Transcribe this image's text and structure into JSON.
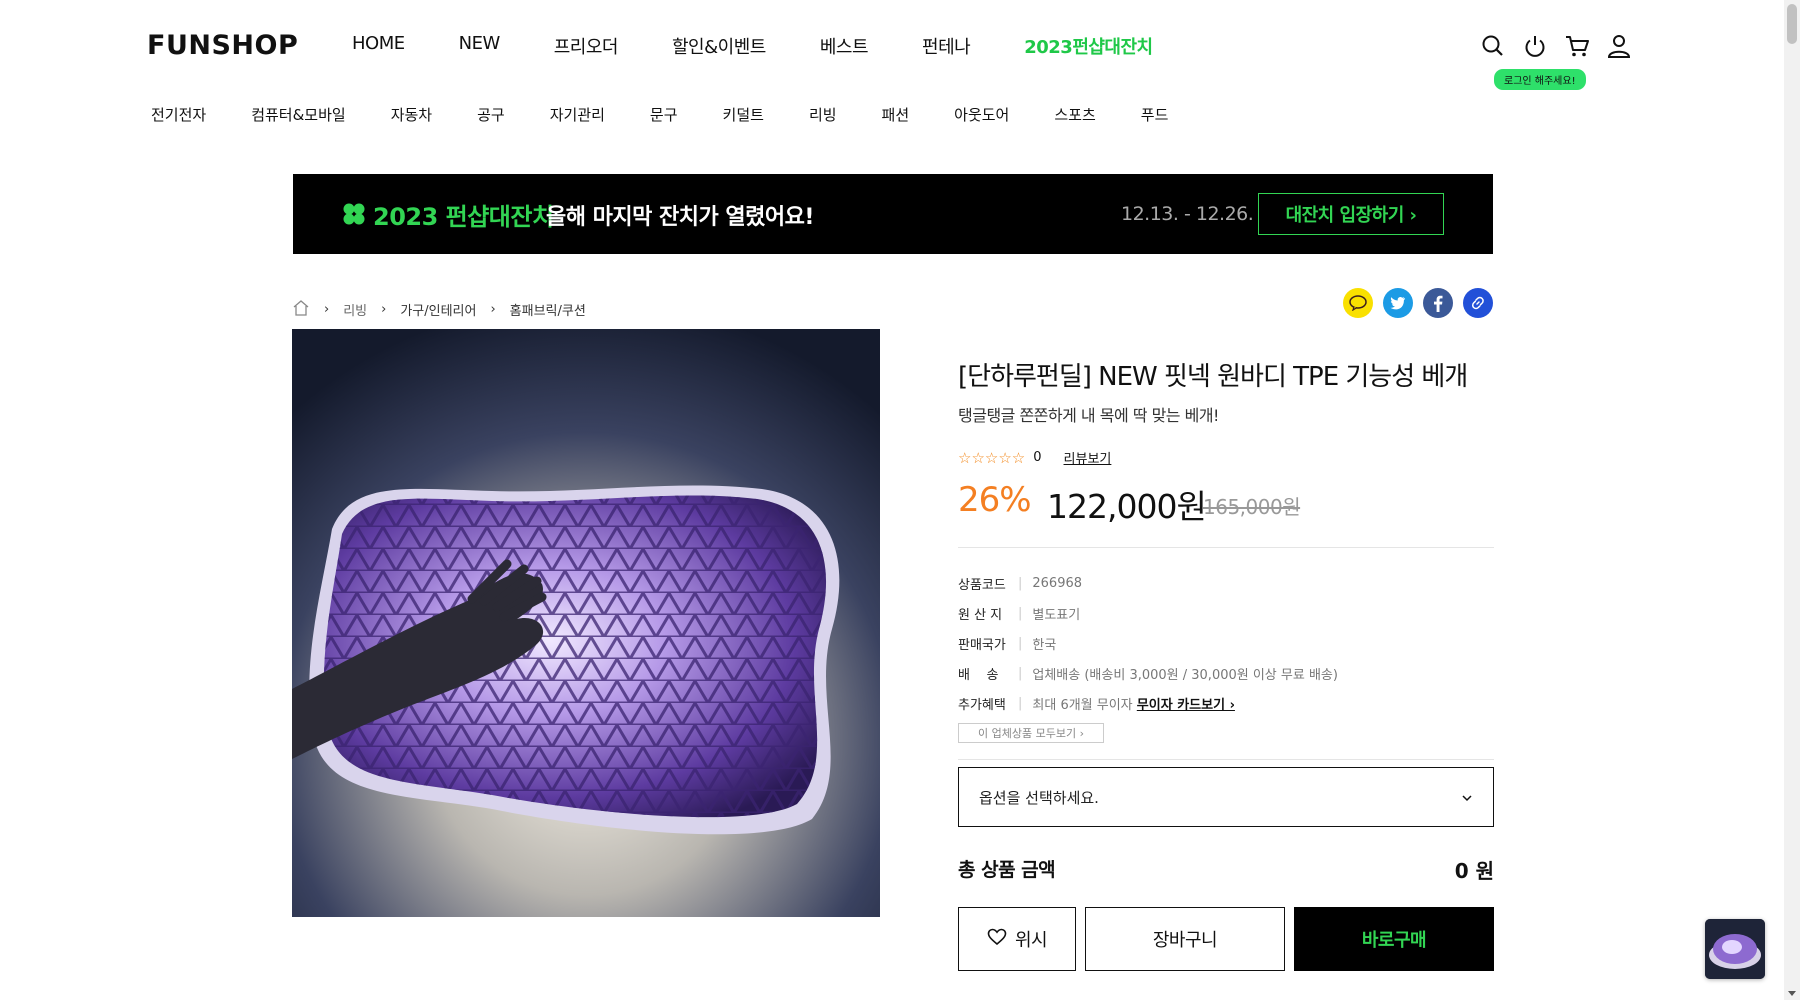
{
  "header": {
    "logo": "FUNSHOP",
    "gnb": [
      "HOME",
      "NEW",
      "프리오더",
      "할인&이벤트",
      "베스트",
      "펀테나",
      "2023펀샵대잔치"
    ],
    "icons": [
      "search-icon",
      "power-icon",
      "cart-icon",
      "user-icon"
    ],
    "login_badge": "로그인 해주세요!"
  },
  "categories": [
    "전기전자",
    "컴퓨터&모바일",
    "자동차",
    "공구",
    "자기관리",
    "문구",
    "키덜트",
    "리빙",
    "패션",
    "아웃도어",
    "스포츠",
    "푸드"
  ],
  "banner": {
    "title_green": "2023 펀샵대잔치",
    "title_white": "올해 마지막 잔치가 열렸어요!",
    "date": "12.13. - 12.26.",
    "button": "대잔치 입장하기 ›"
  },
  "breadcrumb": [
    "리빙",
    "가구/인테리어",
    "홈패브릭/쿠션"
  ],
  "share_icons": [
    "kakao-icon",
    "twitter-icon",
    "facebook-icon",
    "link-icon"
  ],
  "product": {
    "title": "[단하루펀딜] NEW 핏넥 원바디 TPE 기능성 베개",
    "subtitle": "탱글탱글 쫀쫀하게 내 목에 딱 맞는 베개!",
    "stars": "☆☆☆☆☆",
    "rating_count": "0",
    "review_link": "리뷰보기",
    "discount": "26%",
    "price": "122,000원",
    "original_price": "165,000원",
    "specs": [
      {
        "k": "상품코드",
        "v": "266968"
      },
      {
        "k": "원 산 지",
        "v": "별도표기"
      },
      {
        "k": "판매국가",
        "v": "한국"
      },
      {
        "k": "배    송",
        "v": "업체배송 (배송비 3,000원 / 30,000원 이상 무료 배송)"
      },
      {
        "k": "추가혜택",
        "v": "최대 6개월 무이자",
        "link": "무이자 카드보기 ›"
      }
    ],
    "vendor_all": "이 업체상품 모두보기 ›",
    "option_placeholder": "옵션을 선택하세요.",
    "total_label": "총 상품 금액",
    "total_value": "0 원",
    "wish": "위시",
    "cart": "장바구니",
    "buy": "바로구매"
  },
  "colors": {
    "accent_green": "#32d553",
    "discount_orange": "#f47f22"
  }
}
